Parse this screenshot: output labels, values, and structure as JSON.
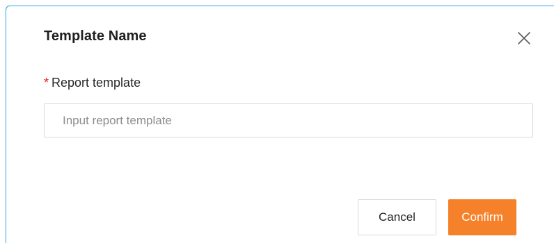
{
  "dialog": {
    "title": "Template Name",
    "close_icon": "close-icon",
    "field": {
      "required_marker": "*",
      "label": "Report template",
      "value": "",
      "placeholder": "Input report template"
    },
    "buttons": {
      "cancel_label": "Cancel",
      "confirm_label": "Confirm"
    }
  },
  "colors": {
    "accent": "#f5812a",
    "required": "#f5222d",
    "frame_border": "#29a3e6"
  }
}
